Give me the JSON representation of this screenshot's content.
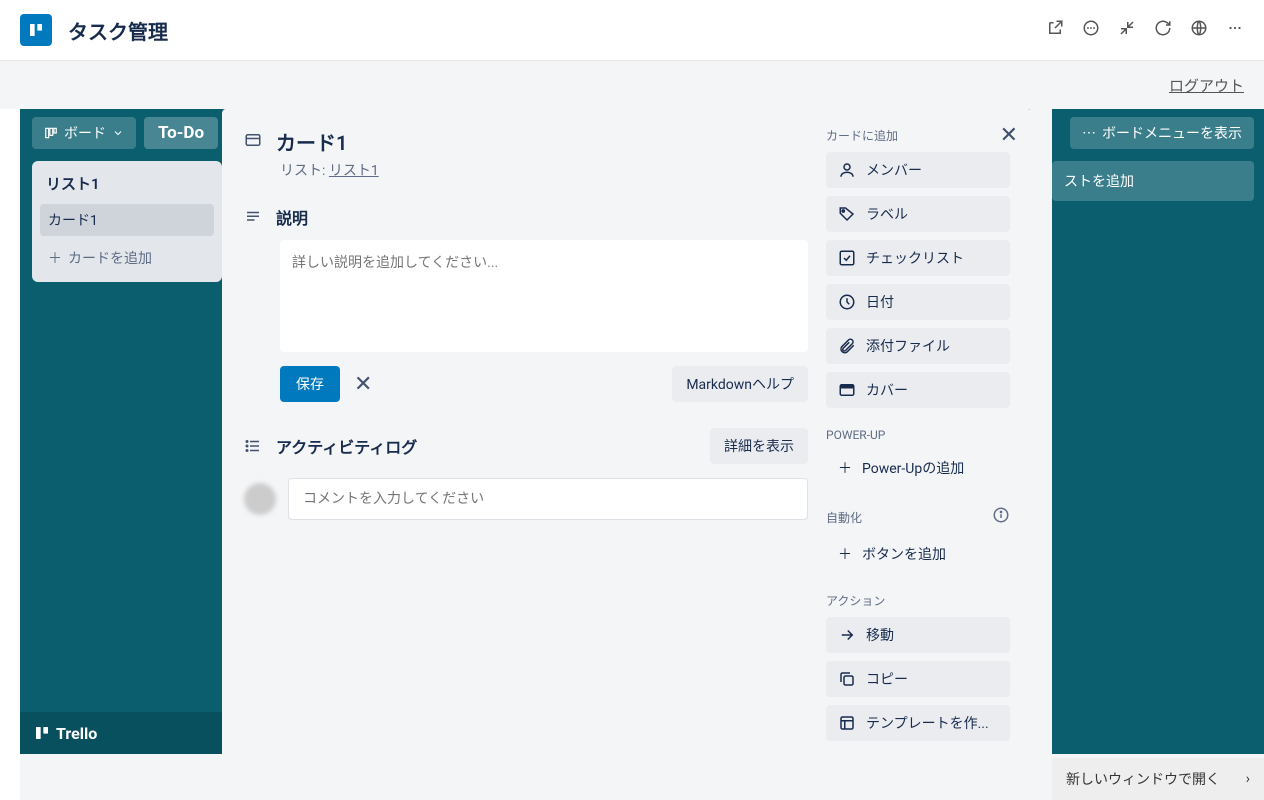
{
  "header": {
    "title": "タスク管理",
    "logout": "ログアウト"
  },
  "board": {
    "view_btn": "ボード",
    "title": "To-Do",
    "menu_btn": "ボードメニューを表示",
    "list_name": "リスト1",
    "card1": "カード1",
    "add_card": "カードを追加",
    "add_list": "ストを追加",
    "footer_brand": "Trello",
    "footer_newwin": "新しいウィンドウで開く"
  },
  "modal": {
    "card_title": "カード1",
    "list_prefix": "リスト: ",
    "list_link": "リスト1",
    "desc_title": "説明",
    "desc_placeholder": "詳しい説明を追加してください...",
    "save": "保存",
    "md_help": "Markdownヘルプ",
    "activity_title": "アクティビティログ",
    "show_details": "詳細を表示",
    "comment_placeholder": "コメントを入力してください"
  },
  "side": {
    "add_to_card": "カードに追加",
    "members": "メンバー",
    "labels": "ラベル",
    "checklist": "チェックリスト",
    "dates": "日付",
    "attachment": "添付ファイル",
    "cover": "カバー",
    "powerup_title": "POWER-UP",
    "powerup_add": "Power-Upの追加",
    "automation_title": "自動化",
    "add_button": "ボタンを追加",
    "actions_title": "アクション",
    "move": "移動",
    "copy": "コピー",
    "template": "テンプレートを作..."
  }
}
